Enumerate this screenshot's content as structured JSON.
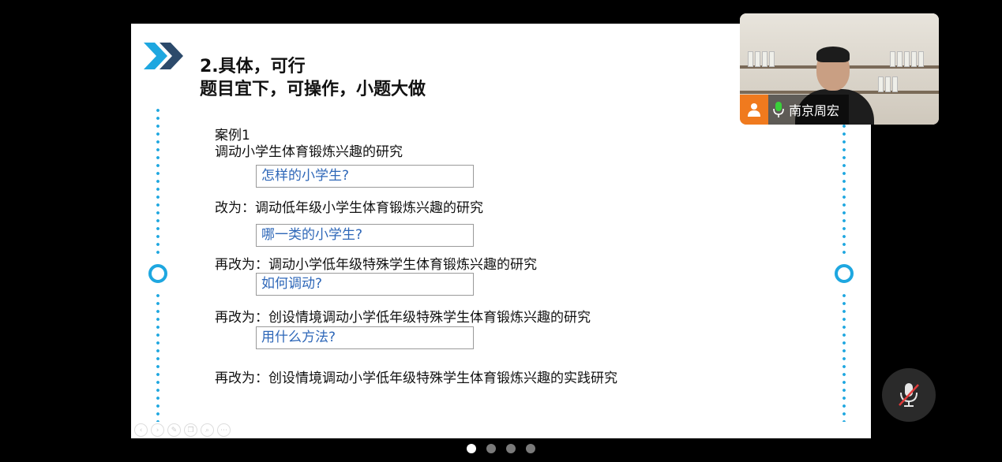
{
  "slide": {
    "title_line1": "2.具体，可行",
    "title_line2": "题目宜下，可操作，小题大做",
    "case_label": "案例1",
    "line1": "调动小学生体育锻炼兴趣的研究",
    "box1": "怎样的小学生?",
    "line2": "改为：调动低年级小学生体育锻炼兴趣的研究",
    "box2": "哪一类的小学生?",
    "line3": "再改为：调动小学低年级特殊学生体育锻炼兴趣的研究",
    "box3": "如何调动?",
    "line4": "再改为：创设情境调动小学低年级特殊学生体育锻炼兴趣的研究",
    "box4": "用什么方法?",
    "line5": "再改为：创设情境调动小学低年级特殊学生体育锻炼兴趣的实践研究",
    "accent_color": "#1ea7e0"
  },
  "toolbar": {
    "icons": [
      "prev-icon",
      "next-icon",
      "pen-icon",
      "copy-icon",
      "zoom-icon",
      "more-icon"
    ]
  },
  "video": {
    "participant_name": "南京周宏",
    "avatar_color": "#f07a1e"
  },
  "controls": {
    "mic_state": "muted"
  },
  "pager": {
    "count": 4,
    "active_index": 0
  }
}
